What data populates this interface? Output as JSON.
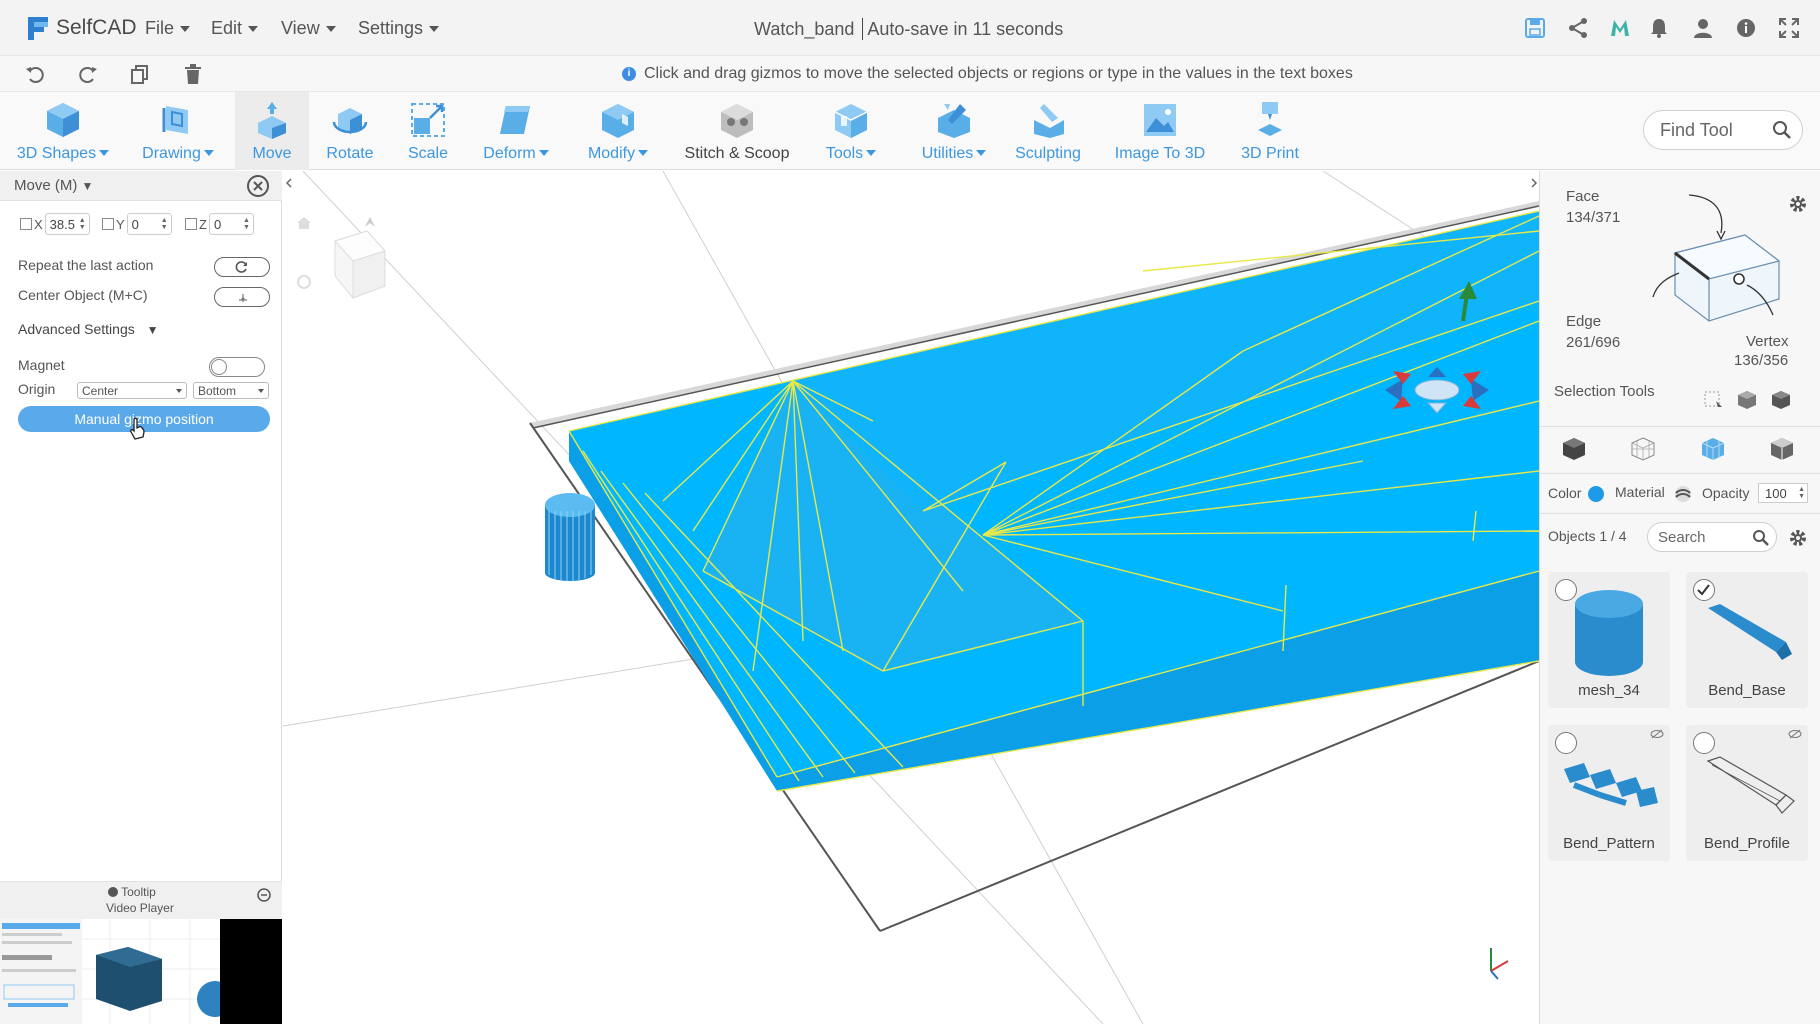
{
  "app": {
    "name": "SelfCAD"
  },
  "menu": {
    "file": "File",
    "edit": "Edit",
    "view": "View",
    "settings": "Settings"
  },
  "document": {
    "name": "Watch_band",
    "autosave": "Auto-save in 11 seconds"
  },
  "hint": "Click and drag gizmos to move the selected objects or regions or type in the values in the text boxes",
  "toolbar": {
    "tools": [
      {
        "label": "3D Shapes",
        "dropdown": true
      },
      {
        "label": "Drawing",
        "dropdown": true
      },
      {
        "label": "Move",
        "dropdown": false,
        "active": true
      },
      {
        "label": "Rotate",
        "dropdown": false
      },
      {
        "label": "Scale",
        "dropdown": false
      },
      {
        "label": "Deform",
        "dropdown": true
      },
      {
        "label": "Modify",
        "dropdown": true
      },
      {
        "label": "Stitch & Scoop",
        "dropdown": false
      },
      {
        "label": "Tools",
        "dropdown": true
      },
      {
        "label": "Utilities",
        "dropdown": true
      },
      {
        "label": "Sculpting",
        "dropdown": false
      },
      {
        "label": "Image To 3D",
        "dropdown": false
      },
      {
        "label": "3D Print",
        "dropdown": false
      }
    ],
    "find_placeholder": "Find Tool"
  },
  "move_panel": {
    "title": "Move (M)",
    "x_label": "X",
    "x_value": "38.5",
    "y_label": "Y",
    "y_value": "0",
    "z_label": "Z",
    "z_value": "0",
    "repeat_label": "Repeat the last action",
    "center_label": "Center Object (M+C)",
    "advanced_label": "Advanced Settings",
    "magnet_label": "Magnet",
    "origin_label": "Origin",
    "origin_h": "Center",
    "origin_v": "Bottom",
    "manual_gizmo_label": "Manual gizmo position",
    "tooltip_label": "Tooltip",
    "video_label": "Video Player"
  },
  "right_panel": {
    "face_label": "Face",
    "face_value": "134/371",
    "edge_label": "Edge",
    "edge_value": "261/696",
    "vertex_label": "Vertex",
    "vertex_value": "136/356",
    "selection_tools_label": "Selection Tools",
    "color_label": "Color",
    "color_value": "#1e9be8",
    "material_label": "Material",
    "opacity_label": "Opacity",
    "opacity_value": "100",
    "objects_label": "Objects 1 / 4",
    "search_placeholder": "Search",
    "objects": [
      {
        "name": "mesh_34",
        "selected": false,
        "hidden": false
      },
      {
        "name": "Bend_Base",
        "selected": true,
        "hidden": false
      },
      {
        "name": "Bend_Pattern",
        "selected": false,
        "hidden": true
      },
      {
        "name": "Bend_Profile",
        "selected": false,
        "hidden": true
      }
    ]
  },
  "colors": {
    "accent": "#3d97e0",
    "model_fill": "#00bfff",
    "wire": "#e8e84a"
  }
}
